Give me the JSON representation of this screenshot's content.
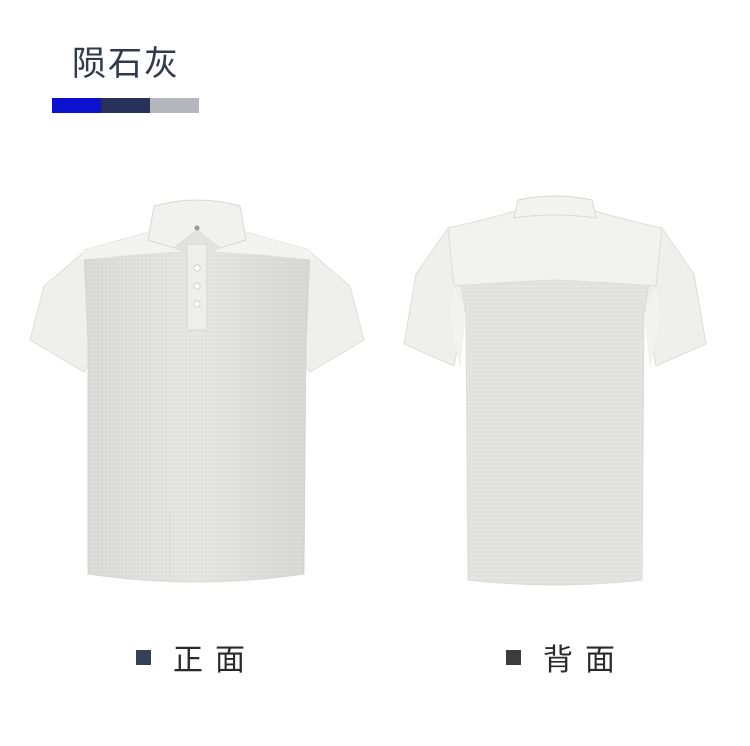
{
  "title": "陨石灰",
  "swatches": [
    {
      "name": "blue",
      "color": "#0d12d1"
    },
    {
      "name": "navy",
      "color": "#27315a"
    },
    {
      "name": "meteorite-grey",
      "color": "#b5b6be"
    }
  ],
  "views": [
    {
      "label": "正面",
      "bullet_color": "#344156"
    },
    {
      "label": "背面",
      "bullet_color": "#3c3c3c"
    }
  ]
}
